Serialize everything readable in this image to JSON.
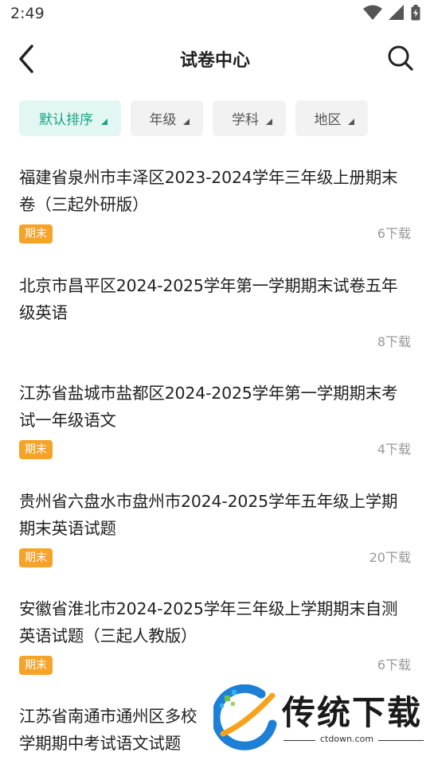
{
  "status_bar": {
    "time": "2:49"
  },
  "header": {
    "title": "试卷中心"
  },
  "filters": [
    {
      "label": "默认排序",
      "active": true
    },
    {
      "label": "年级",
      "active": false
    },
    {
      "label": "学科",
      "active": false
    },
    {
      "label": "地区",
      "active": false
    }
  ],
  "papers": [
    {
      "title": "福建省泉州市丰泽区2023-2024学年三年级上册期末卷（三起外研版）",
      "tag": "期末",
      "downloads": "6下载"
    },
    {
      "title": "北京市昌平区2024-2025学年第一学期期末试卷五年级英语",
      "tag": "",
      "downloads": "8下载"
    },
    {
      "title": "江苏省盐城市盐都区2024-2025学年第一学期期末考试一年级语文",
      "tag": "期末",
      "downloads": "4下载"
    },
    {
      "title": "贵州省六盘水市盘州市2024-2025学年五年级上学期期末英语试题",
      "tag": "期末",
      "downloads": "20下载"
    },
    {
      "title": "安徽省淮北市2024-2025学年三年级上学期期末自测英语试题（三起人教版）",
      "tag": "期末",
      "downloads": "6下载"
    },
    {
      "title": "江苏省南通市通州区多校",
      "title_line2": "学期期中考试语文试题",
      "tag": "",
      "downloads": ""
    }
  ],
  "watermark": {
    "name": "传统下载",
    "url": "ctdown.com"
  },
  "colors": {
    "accent": "#1aa386",
    "accent_bg": "#e3f7f2",
    "tag": "#f6a32a",
    "muted": "#999999"
  }
}
